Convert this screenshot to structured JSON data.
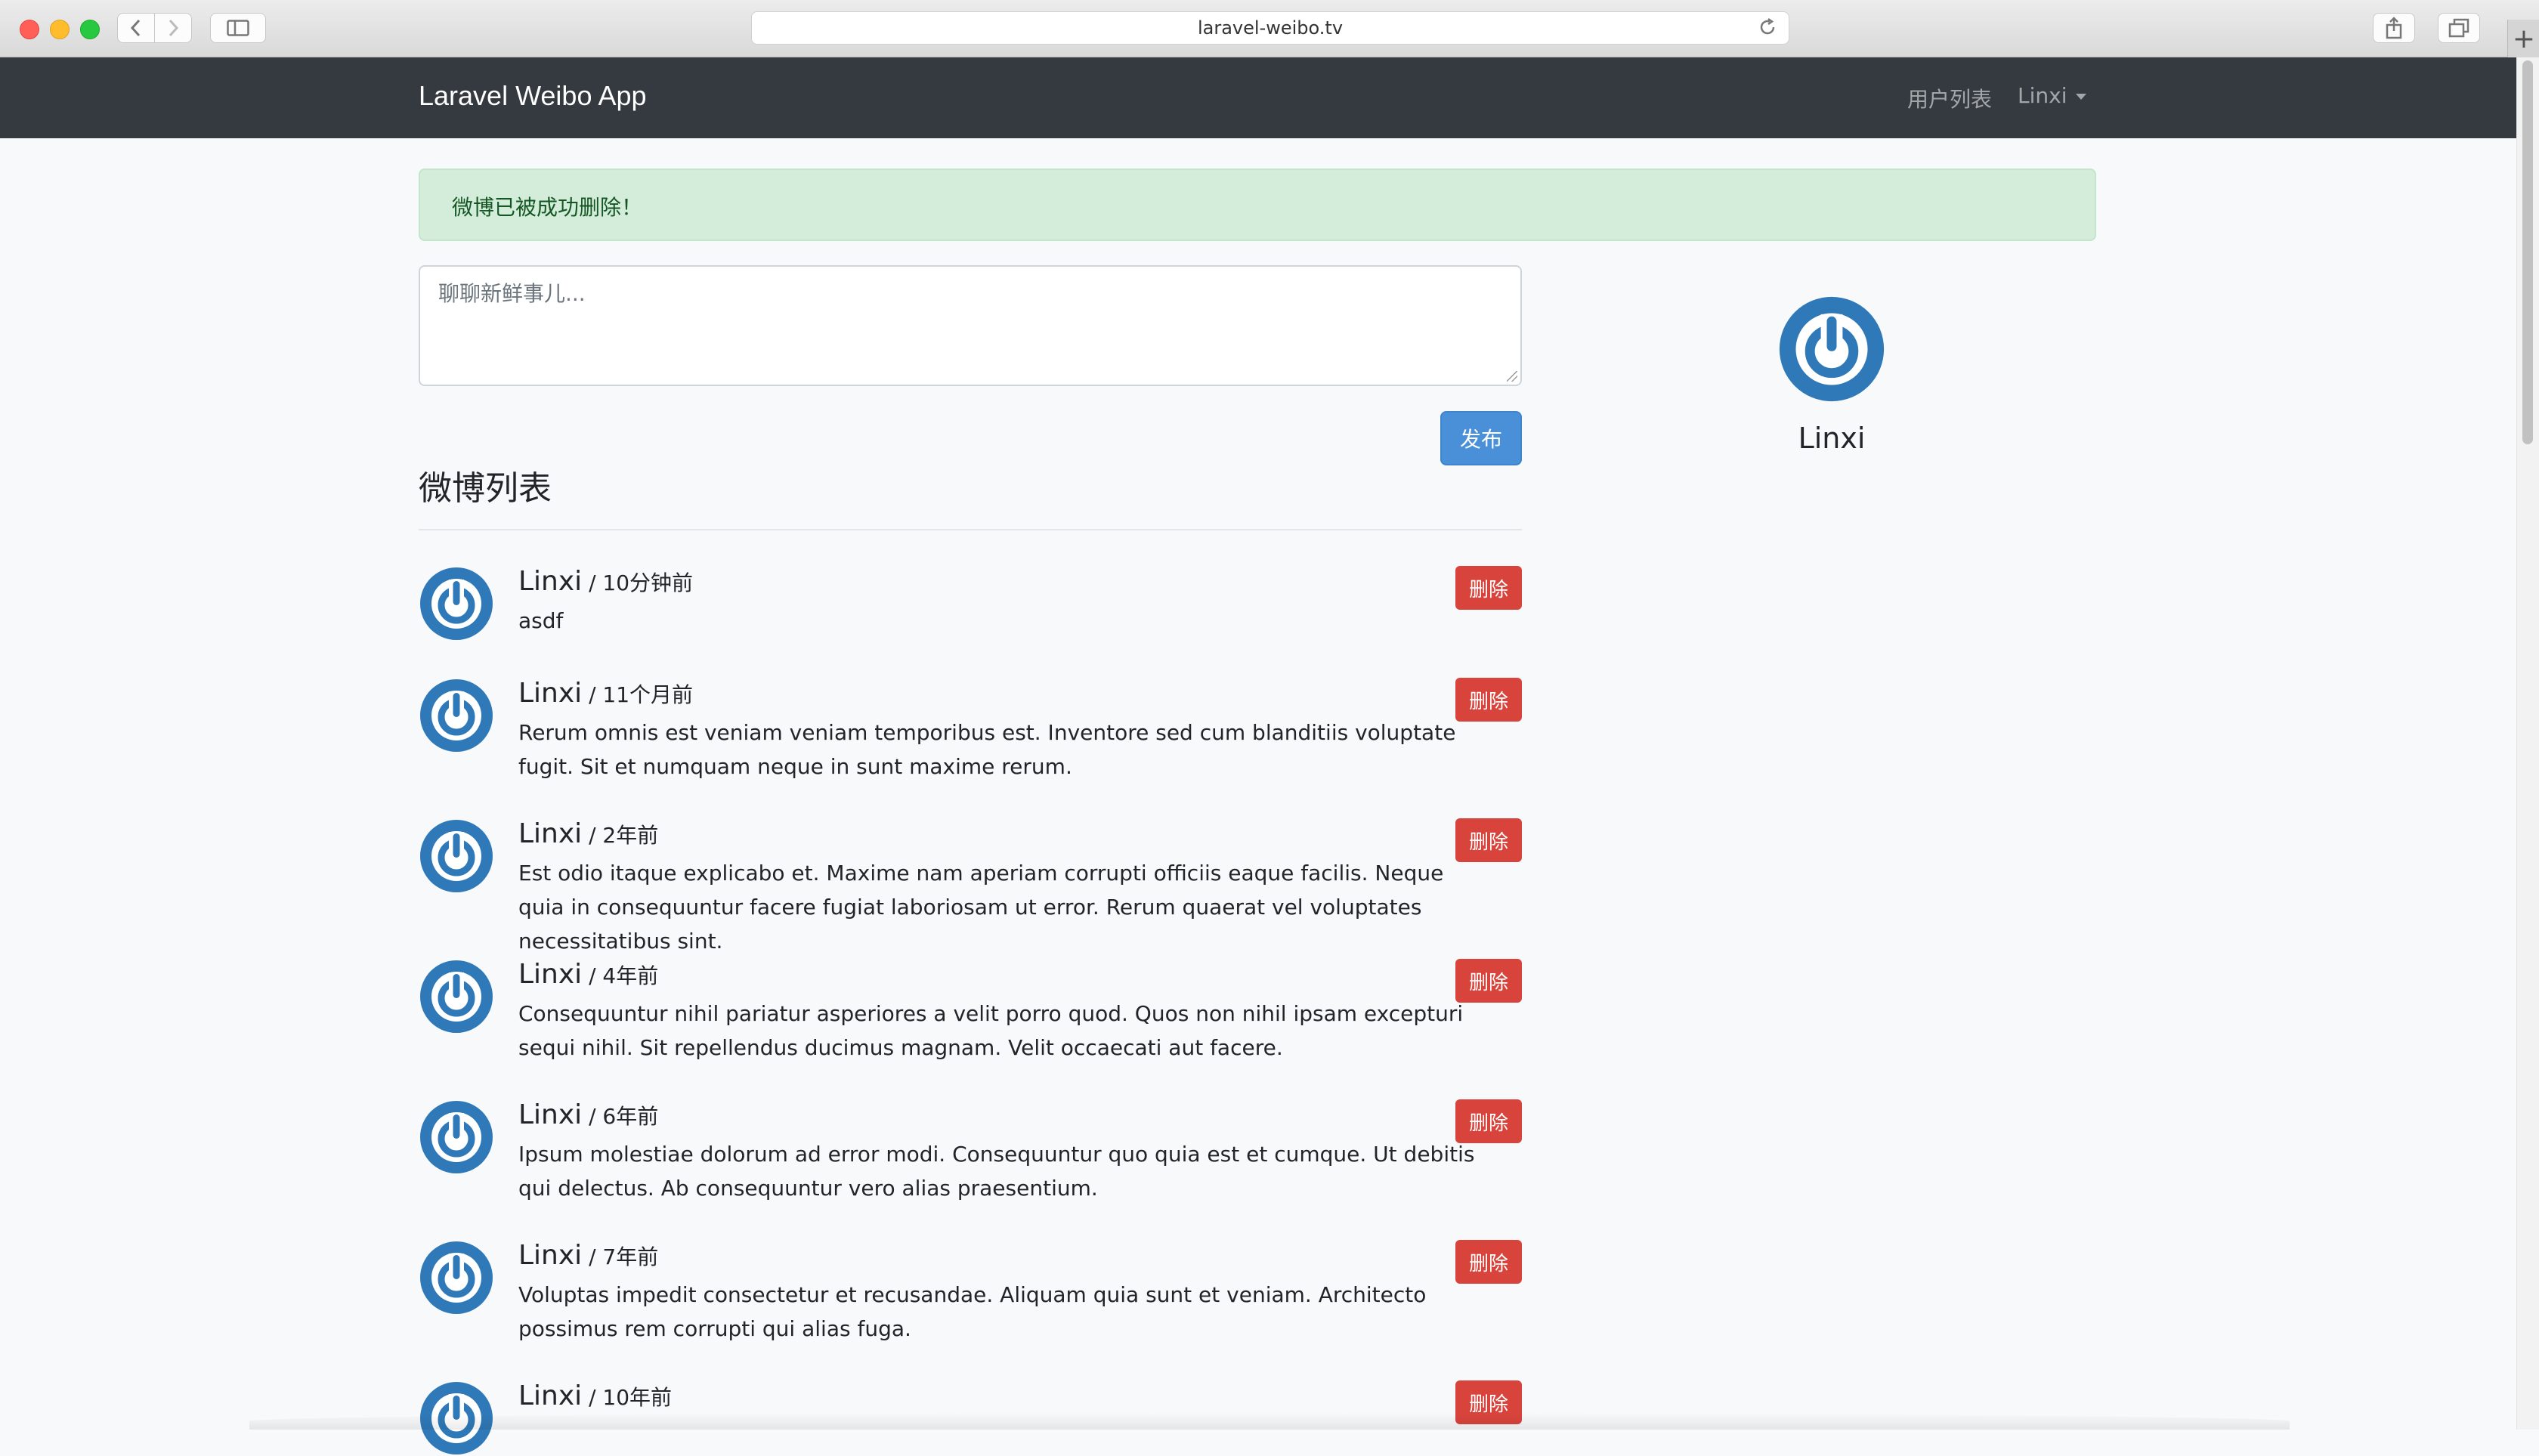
{
  "browser": {
    "url": "laravel-weibo.tv",
    "back_icon": "chevron-left-icon",
    "forward_icon": "chevron-right-icon",
    "sidebar_icon": "sidebar-icon",
    "reload_icon": "reload-icon",
    "share_icon": "share-icon",
    "tabs_icon": "tabs-icon",
    "new_tab_icon": "plus-icon"
  },
  "navbar": {
    "brand": "Laravel Weibo App",
    "users_link": "用户列表",
    "user_menu": "Linxi"
  },
  "alert": {
    "message": "微博已被成功删除！"
  },
  "composer": {
    "placeholder": "聊聊新鲜事儿..."
  },
  "publish_button": "发布",
  "list_title": "微博列表",
  "profile": {
    "name": "Linxi"
  },
  "posts": [
    {
      "user": "Linxi",
      "time": " / 10分钟前",
      "content": "asdf",
      "delete_label": "删除"
    },
    {
      "user": "Linxi",
      "time": " / 11个月前",
      "content": "Rerum omnis est veniam veniam temporibus est. Inventore sed cum blanditiis voluptate fugit. Sit et numquam neque in sunt maxime rerum.",
      "delete_label": "删除"
    },
    {
      "user": "Linxi",
      "time": " / 2年前",
      "content": "Est odio itaque explicabo et. Maxime nam aperiam corrupti officiis eaque facilis. Neque quia in consequuntur facere fugiat laboriosam ut error. Rerum quaerat vel voluptates necessitatibus sint.",
      "delete_label": "删除"
    },
    {
      "user": "Linxi",
      "time": " / 4年前",
      "content": "Consequuntur nihil pariatur asperiores a velit porro quod. Quos non nihil ipsam excepturi sequi nihil. Sit repellendus ducimus magnam. Velit occaecati aut facere.",
      "delete_label": "删除"
    },
    {
      "user": "Linxi",
      "time": " / 6年前",
      "content": "Ipsum molestiae dolorum ad error modi. Consequuntur quo quia est et cumque. Ut debitis qui delectus. Ab consequuntur vero alias praesentium.",
      "delete_label": "删除"
    },
    {
      "user": "Linxi",
      "time": " / 7年前",
      "content": "Voluptas impedit consectetur et recusandae. Aliquam quia sunt et veniam. Architecto possimus rem corrupti qui alias fuga.",
      "delete_label": "删除"
    },
    {
      "user": "Linxi",
      "time": " / 10年前",
      "content": "",
      "delete_label": "删除"
    }
  ],
  "colors": {
    "navbar": "#343a40",
    "alert_bg": "#d4edda",
    "alert_text": "#155724",
    "primary": "#4a90d9",
    "danger": "#d8443c",
    "avatar_blue": "#2f79b9"
  }
}
